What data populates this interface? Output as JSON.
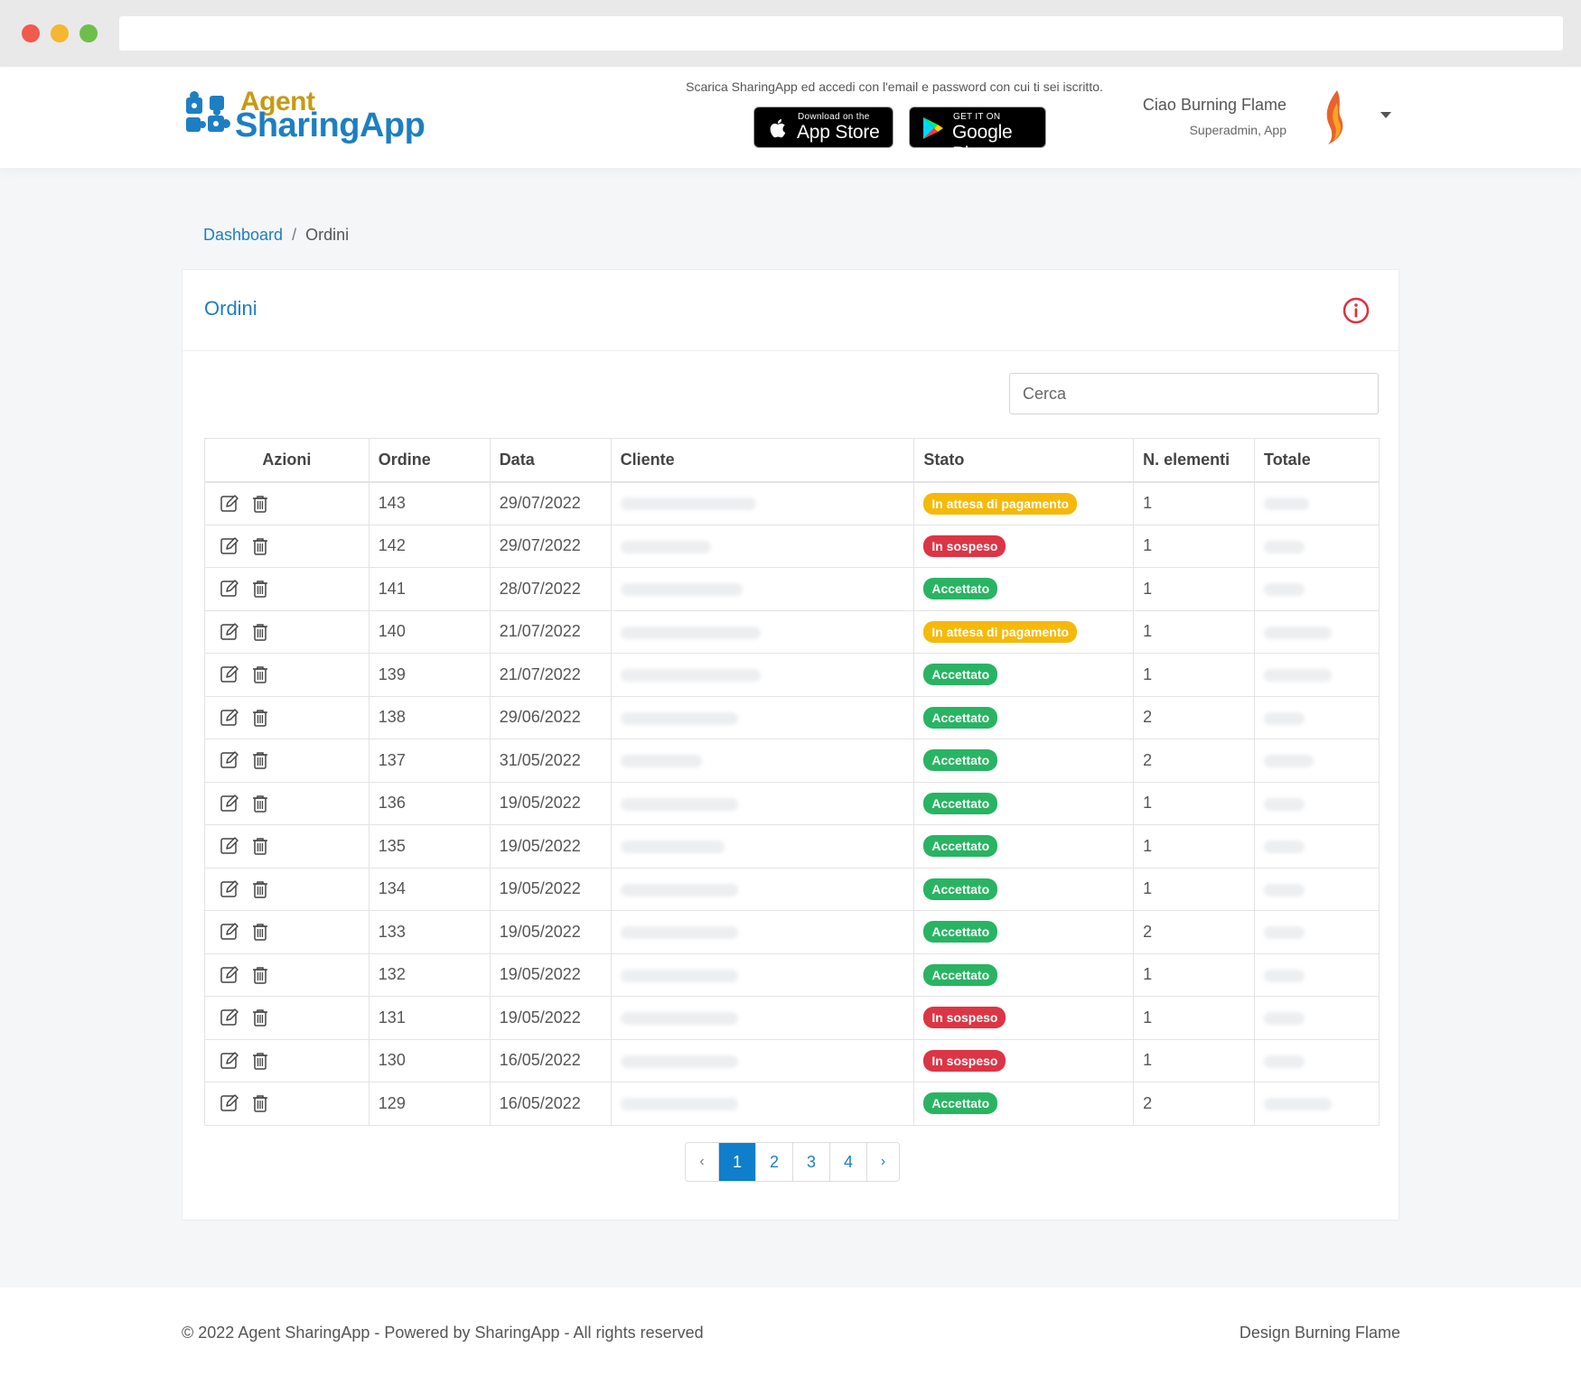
{
  "header": {
    "logo_top": "Agent",
    "logo_bottom": "SharingApp",
    "download_text": "Scarica SharingApp ed accedi con l'email e password con cui ti sei iscritto.",
    "app_store": {
      "small": "Download on the",
      "big": "App Store"
    },
    "google_play": {
      "small": "GET IT ON",
      "big": "Google Play"
    },
    "user_greeting": "Ciao Burning Flame",
    "user_role": "Superadmin, App"
  },
  "breadcrumb": {
    "home": "Dashboard",
    "separator": "/",
    "current": "Ordini"
  },
  "card": {
    "title": "Ordini"
  },
  "search": {
    "placeholder": "Cerca"
  },
  "table": {
    "headers": [
      "Azioni",
      "Ordine",
      "Data",
      "Cliente",
      "Stato",
      "N. elementi",
      "Totale"
    ],
    "rows": [
      {
        "order": "143",
        "date": "29/07/2022",
        "status": "In attesa di pagamento",
        "status_type": "pending",
        "items": "1"
      },
      {
        "order": "142",
        "date": "29/07/2022",
        "status": "In sospeso",
        "status_type": "suspended",
        "items": "1"
      },
      {
        "order": "141",
        "date": "28/07/2022",
        "status": "Accettato",
        "status_type": "accepted",
        "items": "1"
      },
      {
        "order": "140",
        "date": "21/07/2022",
        "status": "In attesa di pagamento",
        "status_type": "pending",
        "items": "1"
      },
      {
        "order": "139",
        "date": "21/07/2022",
        "status": "Accettato",
        "status_type": "accepted",
        "items": "1"
      },
      {
        "order": "138",
        "date": "29/06/2022",
        "status": "Accettato",
        "status_type": "accepted",
        "items": "2"
      },
      {
        "order": "137",
        "date": "31/05/2022",
        "status": "Accettato",
        "status_type": "accepted",
        "items": "2"
      },
      {
        "order": "136",
        "date": "19/05/2022",
        "status": "Accettato",
        "status_type": "accepted",
        "items": "1"
      },
      {
        "order": "135",
        "date": "19/05/2022",
        "status": "Accettato",
        "status_type": "accepted",
        "items": "1"
      },
      {
        "order": "134",
        "date": "19/05/2022",
        "status": "Accettato",
        "status_type": "accepted",
        "items": "1"
      },
      {
        "order": "133",
        "date": "19/05/2022",
        "status": "Accettato",
        "status_type": "accepted",
        "items": "2"
      },
      {
        "order": "132",
        "date": "19/05/2022",
        "status": "Accettato",
        "status_type": "accepted",
        "items": "1"
      },
      {
        "order": "131",
        "date": "19/05/2022",
        "status": "In sospeso",
        "status_type": "suspended",
        "items": "1"
      },
      {
        "order": "130",
        "date": "16/05/2022",
        "status": "In sospeso",
        "status_type": "suspended",
        "items": "1"
      },
      {
        "order": "129",
        "date": "16/05/2022",
        "status": "Accettato",
        "status_type": "accepted",
        "items": "2"
      }
    ]
  },
  "status_colors": {
    "pending": "#f5b90a",
    "suspended": "#dc3545",
    "accepted": "#28b463"
  },
  "pagination": {
    "prev": "‹",
    "pages": [
      "1",
      "2",
      "3",
      "4"
    ],
    "active": "1",
    "next": "›"
  },
  "footer": {
    "left": "© 2022 Agent SharingApp - Powered by SharingApp - All rights reserved",
    "right": "Design Burning Flame"
  },
  "icons": {
    "edit": "edit-icon",
    "delete": "trash-icon",
    "info": "info-icon"
  },
  "colors": {
    "primary": "#1e7ec0",
    "page_bg": "#f4f6f8"
  }
}
